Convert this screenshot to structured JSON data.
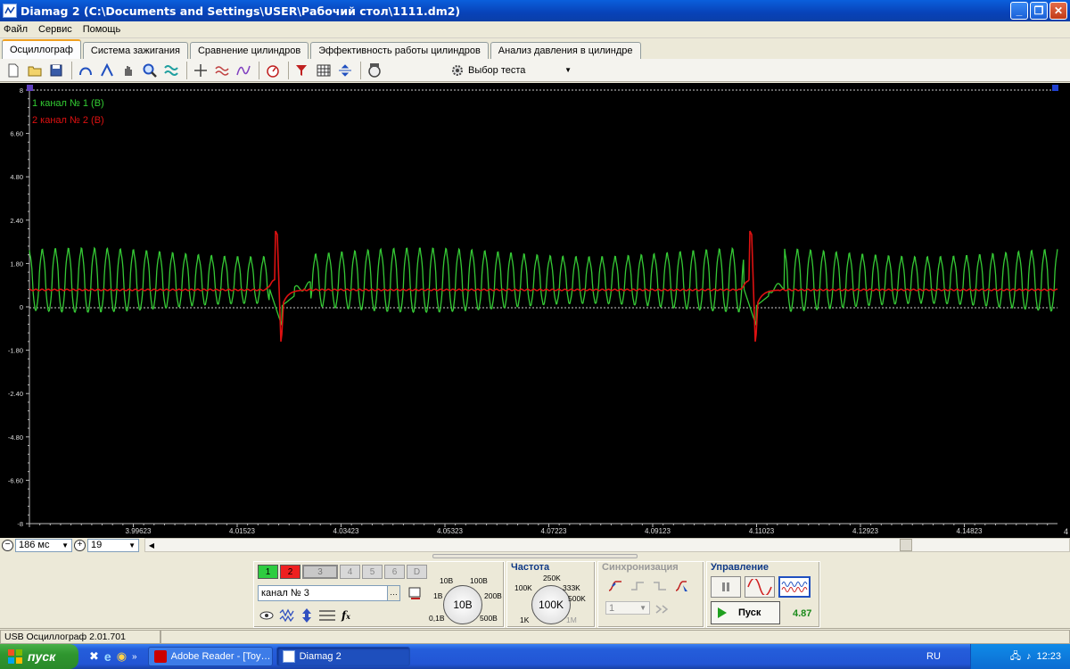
{
  "window": {
    "title": "Diamag 2 (C:\\Documents and Settings\\USER\\Рабочий стол\\1111.dm2)"
  },
  "menu": [
    "Файл",
    "Сервис",
    "Помощь"
  ],
  "tabs": [
    "Осциллограф",
    "Система зажигания",
    "Сравнение цилиндров",
    "Эффективность работы цилиндров",
    "Анализ давления в цилиндре"
  ],
  "toolbar": {
    "test_select": "Выбор теста"
  },
  "scope": {
    "legend": [
      {
        "label": "1  канал № 1 (В)",
        "color": "#33cc33"
      },
      {
        "label": "2  канал № 2 (В)",
        "color": "#dd1111"
      }
    ],
    "y_ticks": [
      "8",
      "6.60",
      "4.80",
      "2.40",
      "1.80",
      "0",
      "-1.80",
      "-2.40",
      "-4.80",
      "-6.60",
      "-8"
    ],
    "x_ticks": [
      "3.99623",
      "4.01523",
      "4.03423",
      "4.05323",
      "4.07223",
      "4.09123",
      "4.11023",
      "4.12923",
      "4.14823"
    ],
    "marker_left": "1",
    "marker_right": "2",
    "right_edge_label": "4"
  },
  "zoom": {
    "time": "186 мс",
    "scale": "19"
  },
  "channels": {
    "buttons": [
      "1",
      "2",
      "3",
      "4",
      "5",
      "6",
      "D"
    ],
    "selected": "канал № 3"
  },
  "amp": {
    "labels": [
      "10В",
      "100В",
      "1В",
      "200В",
      "0,1В",
      "500В"
    ],
    "value": "10В"
  },
  "freq": {
    "title": "Частота",
    "labels": [
      "250K",
      "100K",
      "333K",
      "500K",
      "1K",
      "1M"
    ],
    "value": "100K"
  },
  "sync": {
    "title": "Синхронизация",
    "value": "1"
  },
  "control": {
    "title": "Управление",
    "start": "Пуск",
    "value": "4.87"
  },
  "status": {
    "text": "USB Осциллограф   2.01.701"
  },
  "taskbar": {
    "start": "пуск",
    "items": [
      "Adobe Reader - [Toy…",
      "Diamag 2"
    ],
    "lang": "RU",
    "clock": "12:23"
  }
}
